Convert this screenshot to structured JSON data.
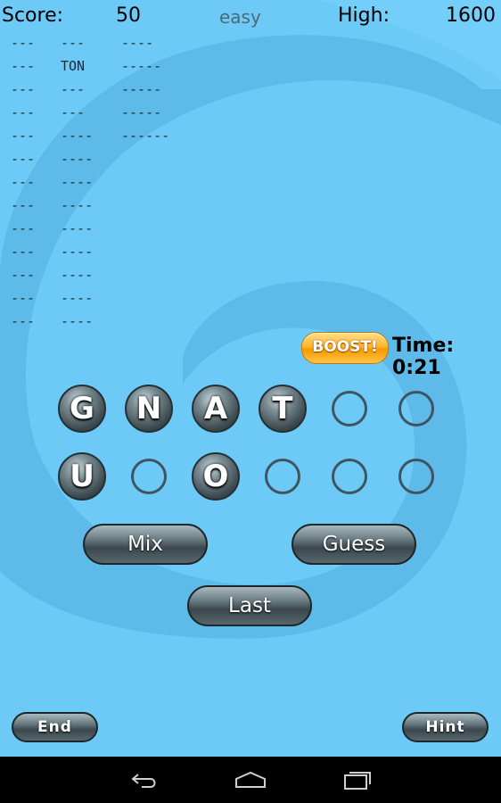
{
  "header": {
    "score_label": "Score:",
    "score_value": "50",
    "difficulty": "easy",
    "high_label": "High:",
    "high_value": "1600"
  },
  "word_list": [
    [
      "---",
      "---",
      "----"
    ],
    [
      "---",
      "TON",
      "-----"
    ],
    [
      "---",
      "---",
      "-----"
    ],
    [
      "---",
      "---",
      "-----"
    ],
    [
      "---",
      "----",
      "------"
    ],
    [
      "---",
      "----",
      ""
    ],
    [
      "---",
      "----",
      ""
    ],
    [
      "---",
      "----",
      ""
    ],
    [
      "---",
      "----",
      ""
    ],
    [
      "---",
      "----",
      ""
    ],
    [
      "---",
      "----",
      ""
    ],
    [
      "---",
      "----",
      ""
    ],
    [
      "---",
      "----",
      ""
    ]
  ],
  "boost_label": "BOOST!",
  "timer": "Time: 0:21",
  "tiles_row1": [
    "G",
    "N",
    "A",
    "T",
    "",
    ""
  ],
  "tiles_row2": [
    "U",
    "",
    "O",
    "",
    "",
    ""
  ],
  "buttons": {
    "mix": "Mix",
    "guess": "Guess",
    "last": "Last",
    "end": "End",
    "hint": "Hint"
  },
  "colors": {
    "background": "#6dcaf6",
    "boost": "#ffb52e"
  },
  "nav_icons": [
    "back-icon",
    "home-icon",
    "recent-apps-icon"
  ]
}
